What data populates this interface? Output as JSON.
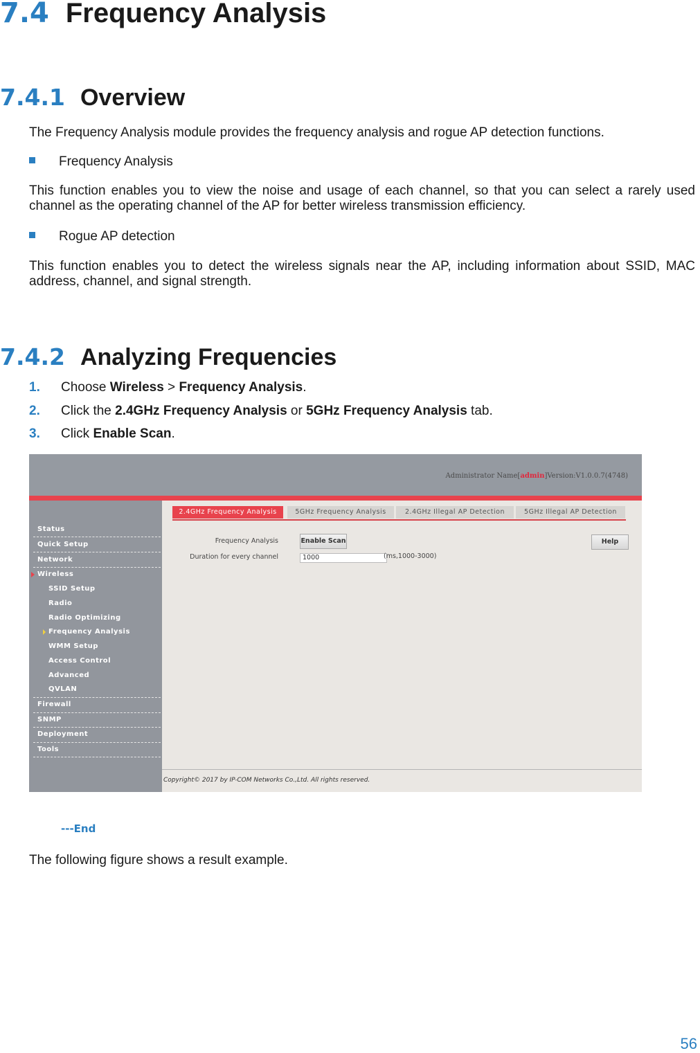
{
  "section": {
    "number": "7.4",
    "title": "Frequency Analysis"
  },
  "overview": {
    "number": "7.4.1",
    "title": "Overview",
    "intro": "The Frequency Analysis module provides the frequency analysis and rogue AP detection functions.",
    "bullets": [
      {
        "label": "Frequency Analysis",
        "text": "This function enables you to view the noise and usage of each channel, so that you can select a rarely used channel as the operating channel of the AP for better wireless transmission efficiency."
      },
      {
        "label": "Rogue AP detection",
        "text": "This function enables you to detect the wireless signals near the AP, including information about SSID, MAC address, channel, and signal strength."
      }
    ]
  },
  "analyzing": {
    "number": "7.4.2",
    "title": "Analyzing Frequencies",
    "steps": [
      {
        "n": "1.",
        "pre": "Choose ",
        "b1": "Wireless",
        "mid": " > ",
        "b2": "Frequency Analysis",
        "post": "."
      },
      {
        "n": "2.",
        "pre": "Click the ",
        "b1": "2.4GHz Frequency Analysis",
        "mid": " or ",
        "b2": "5GHz Frequency Analysis",
        "post": " tab."
      },
      {
        "n": "3.",
        "pre": "Click ",
        "b1": "Enable Scan",
        "mid": "",
        "b2": "",
        "post": "."
      }
    ]
  },
  "screenshot": {
    "header": {
      "admin_prefix": "Administrator Name[",
      "admin_name": "admin",
      "version": "]Version:V1.0.0.7(4748)"
    },
    "sidebar": [
      {
        "label": "Status"
      },
      {
        "label": "Quick Setup"
      },
      {
        "label": "Network"
      },
      {
        "label": "Wireless"
      },
      {
        "label": "SSID Setup"
      },
      {
        "label": "Radio"
      },
      {
        "label": "Radio Optimizing"
      },
      {
        "label": "Frequency Analysis"
      },
      {
        "label": "WMM Setup"
      },
      {
        "label": "Access Control"
      },
      {
        "label": "Advanced"
      },
      {
        "label": "QVLAN"
      },
      {
        "label": "Firewall"
      },
      {
        "label": "SNMP"
      },
      {
        "label": "Deployment"
      },
      {
        "label": "Tools"
      }
    ],
    "tabs": [
      "2.4GHz Frequency Analysis",
      "5GHz Frequency Analysis",
      "2.4GHz Illegal AP Detection",
      "5GHz Illegal AP Detection"
    ],
    "active_tab": "2.4GHz Frequency Analysis",
    "form": {
      "freq_label": "Frequency Analysis",
      "enable_scan": "Enable Scan",
      "duration_label": "Duration for every channel",
      "duration_value": "1000",
      "duration_range": "(ms,1000-3000)",
      "help": "Help"
    },
    "copyright": "Copyright© 2017 by IP-COM Networks Co.,Ltd. All rights reserved."
  },
  "end_marker": "---End",
  "result_text": "The following figure shows a result example.",
  "page_number": "56"
}
